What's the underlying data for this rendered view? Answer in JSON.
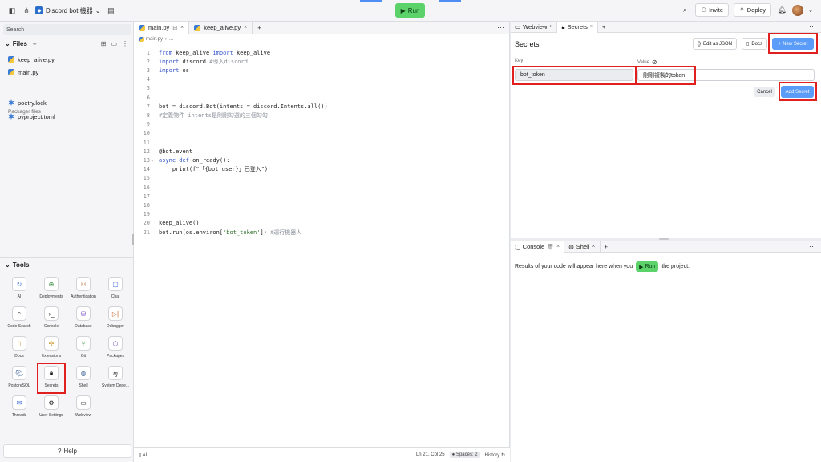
{
  "topbar": {
    "repl_name": "Discord bot 機器",
    "run_label": "Run",
    "invite_label": "Invite",
    "deploy_label": "Deploy"
  },
  "sidebar": {
    "search_placeholder": "Search",
    "files_label": "Files",
    "files": [
      {
        "name": "keep_alive.py"
      },
      {
        "name": "main.py"
      }
    ],
    "packager_label": "Packager files",
    "packager_files": [
      {
        "name": "poetry.lock"
      },
      {
        "name": "pyproject.toml"
      }
    ],
    "tools_label": "Tools",
    "tools": [
      {
        "label": "AI",
        "icon": "ai-icon"
      },
      {
        "label": "Deployments",
        "icon": "deployments-icon"
      },
      {
        "label": "Authentication",
        "icon": "user-icon"
      },
      {
        "label": "Chat",
        "icon": "chat-icon"
      },
      {
        "label": "Code Search",
        "icon": "search-icon"
      },
      {
        "label": "Console",
        "icon": "terminal-icon"
      },
      {
        "label": "Database",
        "icon": "database-icon"
      },
      {
        "label": "Debugger",
        "icon": "debugger-icon"
      },
      {
        "label": "Docs",
        "icon": "docs-icon"
      },
      {
        "label": "Extensions",
        "icon": "puzzle-icon"
      },
      {
        "label": "Git",
        "icon": "git-icon"
      },
      {
        "label": "Packages",
        "icon": "package-icon"
      },
      {
        "label": "PostgreSQL",
        "icon": "postgresql-icon"
      },
      {
        "label": "Secrets",
        "icon": "lock-icon"
      },
      {
        "label": "Shell",
        "icon": "shell-icon"
      },
      {
        "label": "System Depe...",
        "icon": "system-deps-icon"
      },
      {
        "label": "Threads",
        "icon": "threads-icon"
      },
      {
        "label": "User Settings",
        "icon": "gear-icon"
      },
      {
        "label": "Webview",
        "icon": "monitor-icon"
      }
    ],
    "help_label": "Help"
  },
  "editor": {
    "tabs": [
      {
        "label": "main.py"
      },
      {
        "label": "keep_alive.py"
      }
    ],
    "breadcrumb_file": "main.py",
    "breadcrumb_rest": "...",
    "lines": [
      {
        "n": "1",
        "segs": [
          {
            "t": "from",
            "c": "kw"
          },
          {
            "t": " keep_alive ",
            "c": ""
          },
          {
            "t": "import",
            "c": "kw"
          },
          {
            "t": " keep_alive",
            "c": ""
          }
        ]
      },
      {
        "n": "2",
        "segs": [
          {
            "t": "import",
            "c": "kw"
          },
          {
            "t": " discord ",
            "c": ""
          },
          {
            "t": "#導入discord",
            "c": "cm"
          }
        ]
      },
      {
        "n": "3",
        "segs": [
          {
            "t": "import",
            "c": "kw"
          },
          {
            "t": " os",
            "c": ""
          }
        ]
      },
      {
        "n": "4",
        "segs": []
      },
      {
        "n": "5",
        "segs": []
      },
      {
        "n": "6",
        "segs": []
      },
      {
        "n": "7",
        "segs": [
          {
            "t": "bot = discord.Bot(intents = discord.Intents.all())",
            "c": ""
          }
        ]
      },
      {
        "n": "8",
        "segs": [
          {
            "t": "#定義物件 intents是剛剛勾選的三個勾勾",
            "c": "cm"
          }
        ]
      },
      {
        "n": "9",
        "segs": []
      },
      {
        "n": "10",
        "segs": []
      },
      {
        "n": "11",
        "segs": []
      },
      {
        "n": "12",
        "segs": [
          {
            "t": "@bot.event",
            "c": ""
          }
        ]
      },
      {
        "n": "13",
        "segs": [
          {
            "t": "async",
            "c": "kw"
          },
          {
            "t": " ",
            "c": ""
          },
          {
            "t": "def",
            "c": "kw"
          },
          {
            "t": " on_ready():",
            "c": ""
          }
        ]
      },
      {
        "n": "14",
        "segs": [
          {
            "t": "    print(f\"「{bot.user}」已登入\")",
            "c": ""
          }
        ]
      },
      {
        "n": "15",
        "segs": []
      },
      {
        "n": "16",
        "segs": []
      },
      {
        "n": "17",
        "segs": []
      },
      {
        "n": "18",
        "segs": []
      },
      {
        "n": "19",
        "segs": []
      },
      {
        "n": "20",
        "segs": [
          {
            "t": "keep_alive()",
            "c": ""
          }
        ]
      },
      {
        "n": "21",
        "segs": [
          {
            "t": "bot.run(os.environ[",
            "c": ""
          },
          {
            "t": "'bot_token'",
            "c": "st"
          },
          {
            "t": "]) ",
            "c": ""
          },
          {
            "t": "#運行機器人",
            "c": "cm"
          }
        ]
      }
    ],
    "status": {
      "ai": "AI",
      "position": "Ln 21, Col 25",
      "spaces": "Spaces: 2",
      "history": "History"
    }
  },
  "secrets_pane": {
    "tabs": [
      {
        "label": "Webview"
      },
      {
        "label": "Secrets"
      }
    ],
    "title": "Secrets",
    "edit_json": "Edit as JSON",
    "docs": "Docs",
    "new_secret": "New Secret",
    "key_label": "Key",
    "value_label": "Value",
    "key_value": "bot_token",
    "value_value": "剛剛複製的token",
    "cancel": "Cancel",
    "add_secret": "Add Secret"
  },
  "console_pane": {
    "tabs": [
      {
        "label": "Console"
      },
      {
        "label": "Shell"
      }
    ],
    "msg_before": "Results of your code will appear here when you",
    "run_label": "Run",
    "msg_after": "the project."
  },
  "colors": {
    "run_green": "#5bd26a",
    "primary_blue": "#5a9cf8",
    "highlight_red": "#e0201f"
  }
}
